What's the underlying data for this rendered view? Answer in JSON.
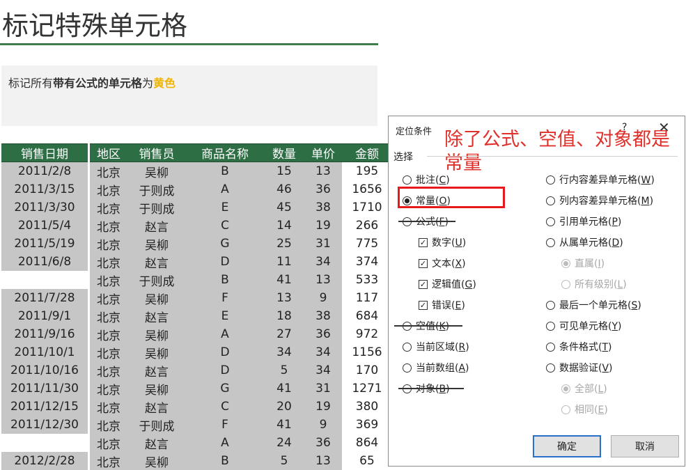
{
  "page": {
    "title": "标记特殊单元格",
    "desc_prefix": "标记所有",
    "desc_bold": "带有公式的单元格",
    "desc_mid": "为",
    "desc_yellow": "黄色"
  },
  "sheet": {
    "headers": [
      "销售日期",
      "地区",
      "销售员",
      "商品名称",
      "数量",
      "单价",
      "金额"
    ],
    "rows": [
      [
        "2011/2/8",
        "北京",
        "吴柳",
        "B",
        "15",
        "13",
        "195"
      ],
      [
        "2011/3/15",
        "北京",
        "于则成",
        "A",
        "46",
        "36",
        "1656"
      ],
      [
        "2011/3/30",
        "北京",
        "于则成",
        "E",
        "45",
        "38",
        "1710"
      ],
      [
        "2011/5/4",
        "北京",
        "赵言",
        "C",
        "14",
        "19",
        "266"
      ],
      [
        "2011/5/19",
        "北京",
        "吴柳",
        "G",
        "25",
        "31",
        "775"
      ],
      [
        "2011/6/8",
        "北京",
        "赵言",
        "D",
        "11",
        "34",
        "374"
      ],
      [
        "",
        "北京",
        "于则成",
        "B",
        "41",
        "13",
        "533"
      ],
      [
        "2011/7/28",
        "北京",
        "吴柳",
        "F",
        "13",
        "9",
        "117"
      ],
      [
        "2011/9/1",
        "北京",
        "赵言",
        "E",
        "18",
        "38",
        "684"
      ],
      [
        "2011/9/16",
        "北京",
        "吴柳",
        "A",
        "27",
        "36",
        "972"
      ],
      [
        "2011/10/1",
        "北京",
        "吴柳",
        "D",
        "34",
        "34",
        "1156"
      ],
      [
        "2011/10/16",
        "北京",
        "赵言",
        "D",
        "5",
        "34",
        "170"
      ],
      [
        "2011/11/30",
        "北京",
        "吴柳",
        "G",
        "41",
        "31",
        "1271"
      ],
      [
        "2011/12/15",
        "北京",
        "赵言",
        "C",
        "20",
        "19",
        "380"
      ],
      [
        "2011/12/30",
        "北京",
        "于则成",
        "F",
        "41",
        "9",
        "369"
      ],
      [
        "",
        "北京",
        "赵言",
        "A",
        "24",
        "36",
        "864"
      ],
      [
        "2012/2/28",
        "北京",
        "吴柳",
        "B",
        "5",
        "13",
        "65"
      ]
    ]
  },
  "dialog": {
    "title": "定位条件",
    "help": "?",
    "close": "✕",
    "note": "除了公式、空值、对象都是常量",
    "group_label": "选择",
    "left_options": [
      {
        "label": "批注(",
        "key": "C",
        "suffix": ")",
        "kind": "radio",
        "checked": false,
        "disabled": false
      },
      {
        "label": "常量(",
        "key": "O",
        "suffix": ")",
        "kind": "radio",
        "checked": true,
        "disabled": false
      },
      {
        "label": "公式(",
        "key": "F",
        "suffix": ")",
        "kind": "radio",
        "checked": false,
        "disabled": false
      },
      {
        "label": "数字(",
        "key": "U",
        "suffix": ")",
        "kind": "check",
        "checked": true,
        "disabled": false
      },
      {
        "label": "文本(",
        "key": "X",
        "suffix": ")",
        "kind": "check",
        "checked": true,
        "disabled": false
      },
      {
        "label": "逻辑值(",
        "key": "G",
        "suffix": ")",
        "kind": "check",
        "checked": true,
        "disabled": false
      },
      {
        "label": "错误(",
        "key": "E",
        "suffix": ")",
        "kind": "check",
        "checked": true,
        "disabled": false
      },
      {
        "label": "空值(",
        "key": "K",
        "suffix": ")",
        "kind": "radio",
        "checked": false,
        "disabled": false
      },
      {
        "label": "当前区域(",
        "key": "R",
        "suffix": ")",
        "kind": "radio",
        "checked": false,
        "disabled": false
      },
      {
        "label": "当前数组(",
        "key": "A",
        "suffix": ")",
        "kind": "radio",
        "checked": false,
        "disabled": false
      },
      {
        "label": "对象(",
        "key": "B",
        "suffix": ")",
        "kind": "radio",
        "checked": false,
        "disabled": false
      }
    ],
    "right_options": [
      {
        "label": "行内容差异单元格(",
        "key": "W",
        "suffix": ")",
        "kind": "radio",
        "checked": false,
        "disabled": false
      },
      {
        "label": "列内容差异单元格(",
        "key": "M",
        "suffix": ")",
        "kind": "radio",
        "checked": false,
        "disabled": false
      },
      {
        "label": "引用单元格(",
        "key": "P",
        "suffix": ")",
        "kind": "radio",
        "checked": false,
        "disabled": false
      },
      {
        "label": "从属单元格(",
        "key": "D",
        "suffix": ")",
        "kind": "radio",
        "checked": false,
        "disabled": false
      },
      {
        "label": "直属(",
        "key": "I",
        "suffix": ")",
        "kind": "radio",
        "checked": true,
        "disabled": true
      },
      {
        "label": "所有级别(",
        "key": "L",
        "suffix": ")",
        "kind": "radio",
        "checked": false,
        "disabled": true
      },
      {
        "label": "最后一个单元格(",
        "key": "S",
        "suffix": ")",
        "kind": "radio",
        "checked": false,
        "disabled": false
      },
      {
        "label": "可见单元格(",
        "key": "Y",
        "suffix": ")",
        "kind": "radio",
        "checked": false,
        "disabled": false
      },
      {
        "label": "条件格式(",
        "key": "T",
        "suffix": ")",
        "kind": "radio",
        "checked": false,
        "disabled": false
      },
      {
        "label": "数据验证(",
        "key": "V",
        "suffix": ")",
        "kind": "radio",
        "checked": false,
        "disabled": false
      },
      {
        "label": "全部(",
        "key": "L",
        "suffix": ")",
        "kind": "radio",
        "checked": true,
        "disabled": true
      },
      {
        "label": "相同(",
        "key": "E",
        "suffix": ")",
        "kind": "radio",
        "checked": false,
        "disabled": true
      }
    ],
    "ok_label": "确定",
    "cancel_label": "取消"
  },
  "colors": {
    "header_green": "#2e6e45",
    "accent_yellow": "#f0b400",
    "annotation_red": "#e0302b"
  }
}
